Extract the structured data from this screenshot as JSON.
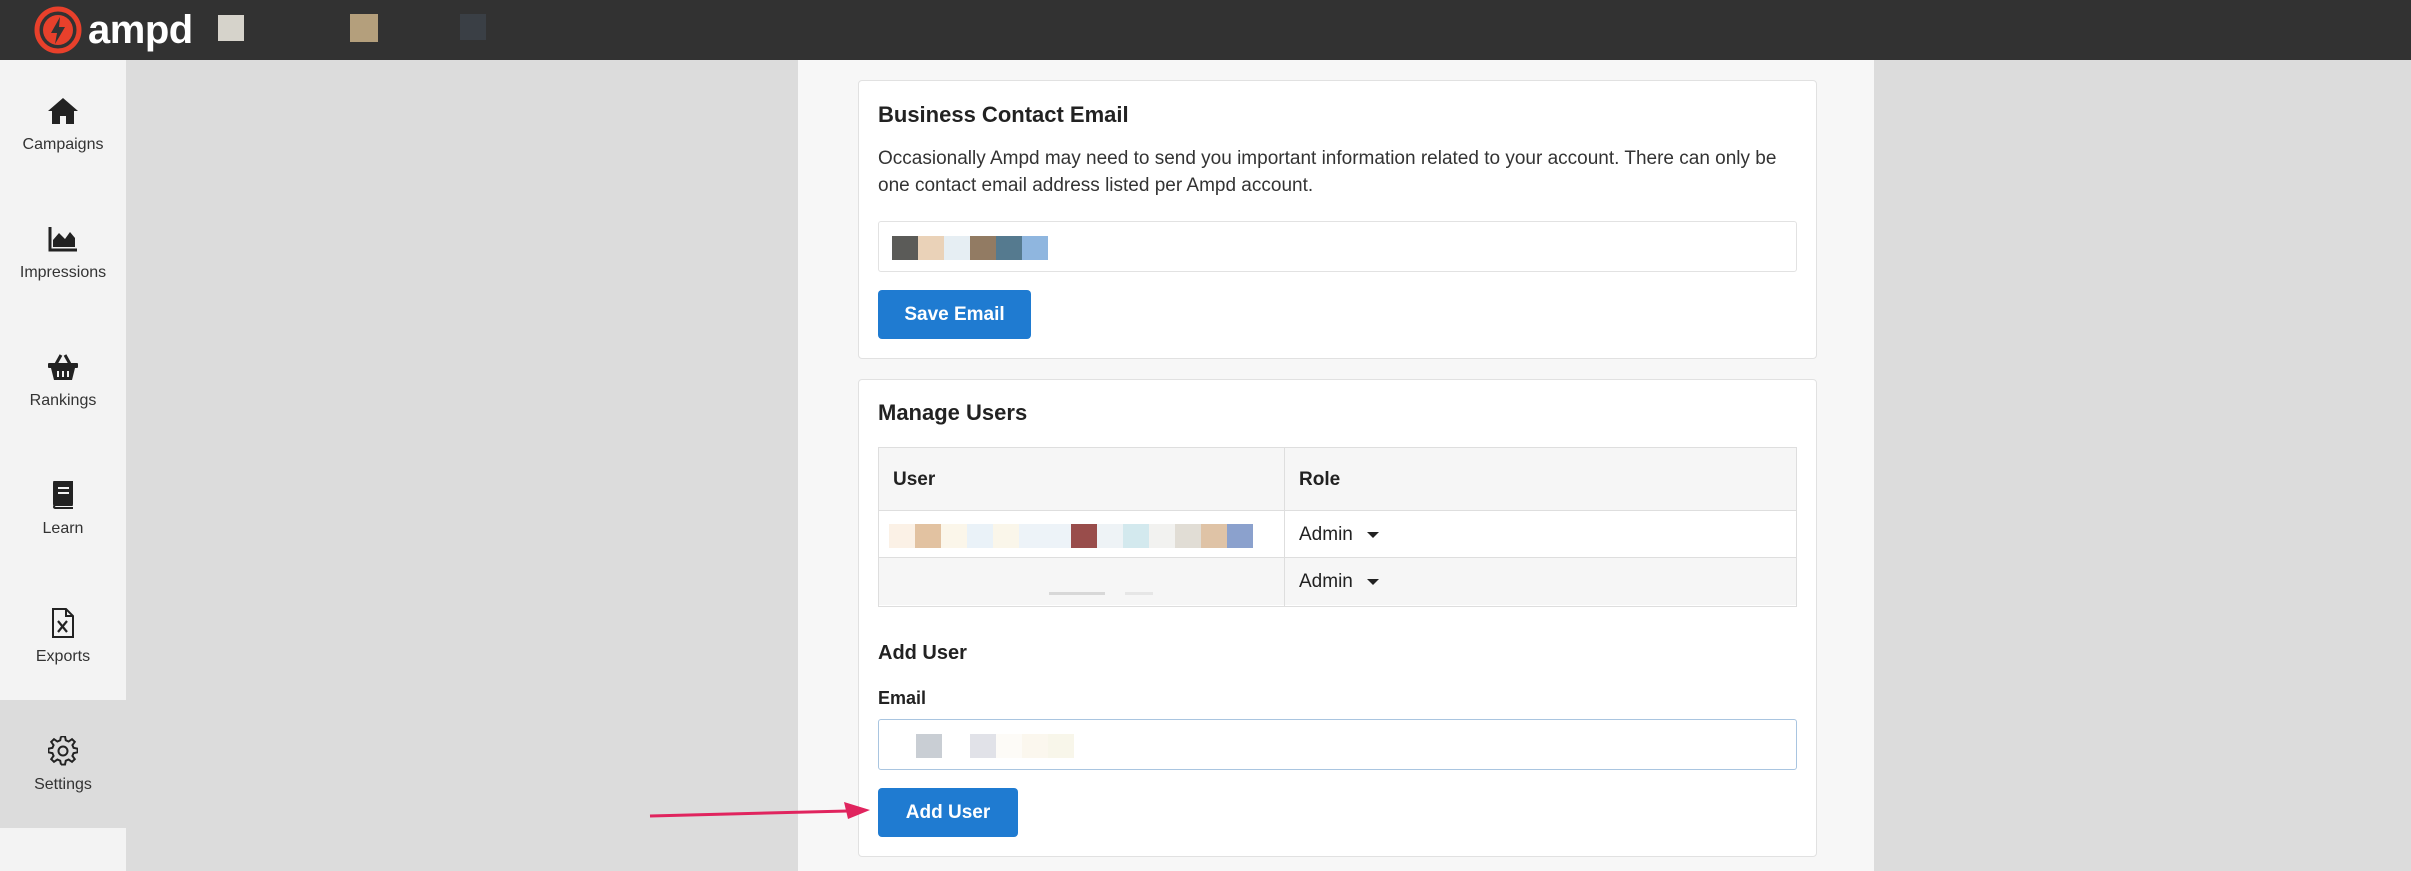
{
  "app": {
    "brand": "ampd",
    "colors": {
      "topbar": "#323232",
      "accent": "#1f7bd1",
      "logo_red": "#e8402b",
      "annotation_arrow": "#e0245e"
    }
  },
  "sidebar": {
    "items": [
      {
        "label": "Campaigns",
        "icon": "home-icon",
        "active": false
      },
      {
        "label": "Impressions",
        "icon": "area-chart-icon",
        "active": false
      },
      {
        "label": "Rankings",
        "icon": "basket-icon",
        "active": false
      },
      {
        "label": "Learn",
        "icon": "book-icon",
        "active": false
      },
      {
        "label": "Exports",
        "icon": "excel-file-icon",
        "active": false
      },
      {
        "label": "Settings",
        "icon": "gear-icon",
        "active": true
      }
    ]
  },
  "contact_email": {
    "title": "Business Contact Email",
    "description": "Occasionally Ampd may need to send you important information related to your account. There can only be one contact email address listed per Ampd account.",
    "save_label": "Save Email"
  },
  "manage_users": {
    "title": "Manage Users",
    "columns": [
      "User",
      "Role"
    ],
    "rows": [
      {
        "role": "Admin"
      },
      {
        "role": "Admin"
      }
    ],
    "add_user": {
      "title": "Add User",
      "email_label": "Email",
      "button_label": "Add User"
    }
  }
}
